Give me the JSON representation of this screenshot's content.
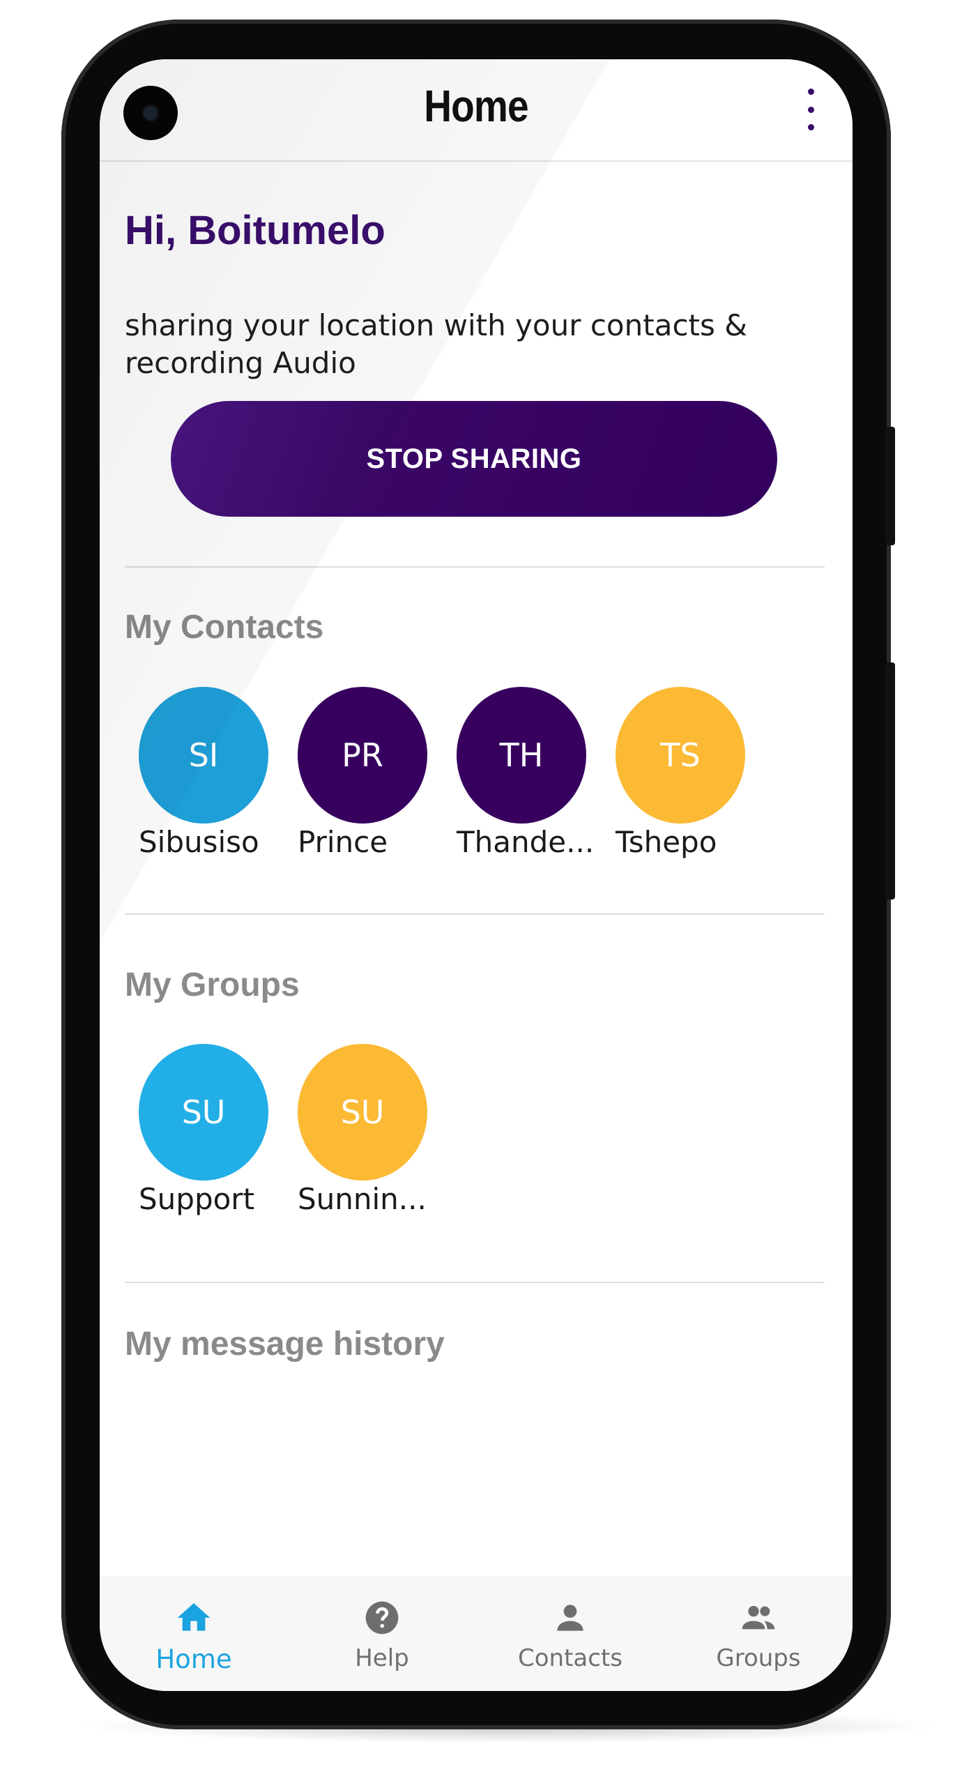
{
  "app_bar": {
    "title": "Home"
  },
  "greeting": "Hi, Boitumelo",
  "status_text": "sharing your location with your contacts & recording Audio",
  "stop_button_label": "STOP SHARING",
  "contacts": {
    "title": "My Contacts",
    "items": [
      {
        "initials": "SI",
        "name": "Sibusiso",
        "color": "#1e9fd8"
      },
      {
        "initials": "PR",
        "name": "Prince",
        "color": "#37005f"
      },
      {
        "initials": "TH",
        "name": "Thande...",
        "color": "#37005f"
      },
      {
        "initials": "TS",
        "name": "Tshepo",
        "color": "#fbb934"
      }
    ]
  },
  "groups": {
    "title": "My Groups",
    "items": [
      {
        "initials": "SU",
        "name": "Support",
        "color": "#22aee6"
      },
      {
        "initials": "SU",
        "name": "Sunnin...",
        "color": "#fbb934"
      }
    ]
  },
  "message_history": {
    "title": "My message history"
  },
  "bottom_nav": {
    "items": [
      {
        "label": "Home",
        "icon": "home-icon",
        "active": true
      },
      {
        "label": "Help",
        "icon": "help-icon",
        "active": false
      },
      {
        "label": "Contacts",
        "icon": "person-icon",
        "active": false
      },
      {
        "label": "Groups",
        "icon": "group-icon",
        "active": false
      }
    ]
  },
  "colors": {
    "primary": "#37005f",
    "accent_blue": "#1aa3e0",
    "accent_yellow": "#fbb934"
  }
}
